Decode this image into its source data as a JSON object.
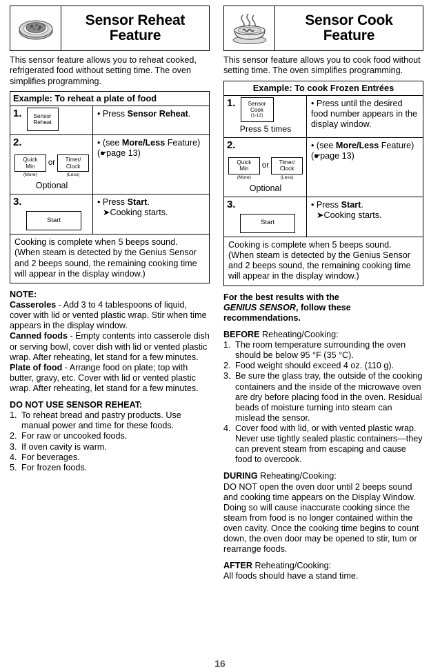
{
  "page": {
    "number": "16"
  },
  "left": {
    "header": {
      "icon": "plate-of-food-icon",
      "title_line1": "Sensor Reheat",
      "title_line2": "Feature"
    },
    "intro": "This sensor feature allows you to reheat cooked, refrigerated food without setting time. The oven simplifies programming.",
    "example": {
      "title": "Example: To reheat a plate of food",
      "steps": [
        {
          "num": "1.",
          "button": {
            "line1": "Sensor",
            "line2": "Reheat"
          },
          "instruction_pre": "• Press ",
          "instruction_bold": "Sensor Reheat",
          "instruction_post": "."
        },
        {
          "num": "2.",
          "btn_more": {
            "line1": "Quick",
            "line2": "Min"
          },
          "more_sub": "(More)",
          "or": "or",
          "btn_less": {
            "line1": "Timer/",
            "line2": "Clock"
          },
          "less_sub": "(Less)",
          "optional": "Optional",
          "instruction_pre": "• (see ",
          "instruction_bold": "More/Less",
          "instruction_post": " Feature)",
          "instruction_page": "page 13"
        },
        {
          "num": "3.",
          "button": {
            "line1": "Start"
          },
          "instruction_pre": "• Press ",
          "instruction_bold": "Start",
          "instruction_post": ".",
          "instruction_arrow": "➤Cooking starts."
        }
      ],
      "footer": "Cooking is complete when 5 beeps sound. (When steam is detected by the Genius Sensor and 2 beeps sound, the remaining cooking time will appear in the display window.)"
    },
    "note": {
      "heading": "NOTE:",
      "items": [
        {
          "bold": "Casseroles",
          "text": " - Add 3 to 4 tablespoons of liquid, cover with lid or vented plastic wrap. Stir when time appears in the display window."
        },
        {
          "bold": "Canned foods",
          "text": " - Empty contents into casserole dish or serving bowl, cover dish with lid or vented plastic wrap. After reheating, let stand for a few minutes."
        },
        {
          "bold": "Plate of food",
          "text": " - Arrange food on plate; top with butter, gravy, etc. Cover with lid or vented plastic wrap. After reheating, let stand for a few minutes."
        }
      ]
    },
    "donot": {
      "heading": "DO NOT USE SENSOR REHEAT:",
      "items": [
        {
          "n": "1.",
          "t": "To reheat bread and pastry products. Use manual power and time for these foods."
        },
        {
          "n": "2.",
          "t": "For raw or uncooked foods."
        },
        {
          "n": "3.",
          "t": "If oven cavity is warm."
        },
        {
          "n": "4.",
          "t": "For beverages."
        },
        {
          "n": "5.",
          "t": "For frozen foods."
        }
      ]
    }
  },
  "right": {
    "header": {
      "icon": "bowl-of-soup-icon",
      "title_line1": "Sensor Cook",
      "title_line2": "Feature"
    },
    "intro": "This sensor feature allows you to cook food without setting time. The oven simplifies programming.",
    "example": {
      "title": "Example: To cook Frozen Entrées",
      "steps": [
        {
          "num": "1.",
          "button": {
            "line1": "Sensor",
            "line2": "Cook",
            "line3": "(1-12)"
          },
          "press_times": "Press 5 times",
          "instruction": "• Press until the desired food number appears in the display window."
        },
        {
          "num": "2.",
          "btn_more": {
            "line1": "Quick",
            "line2": "Min"
          },
          "more_sub": "(More)",
          "or": "or",
          "btn_less": {
            "line1": "Timer/",
            "line2": "Clock"
          },
          "less_sub": "(Less)",
          "optional": "Optional",
          "instruction_pre": "• (see ",
          "instruction_bold": "More/Less",
          "instruction_post": " Feature)",
          "instruction_page": "page 13"
        },
        {
          "num": "3.",
          "button": {
            "line1": "Start"
          },
          "instruction_pre": "• Press ",
          "instruction_bold": "Start",
          "instruction_post": ".",
          "instruction_arrow": "➤Cooking starts."
        }
      ],
      "footer": "Cooking is complete when 5 beeps sound. (When steam is detected by the Genius Sensor and 2 beeps sound, the remaining cooking time will appear in the display window.)"
    },
    "best_results": {
      "line1": "For the best results with the",
      "emphasis": "GENIUS SENSOR",
      "line2_rest": ", follow these",
      "line3": "recommendations."
    },
    "before": {
      "label": "BEFORE",
      "label_rest": " Reheating/Cooking:",
      "items": [
        {
          "n": "1.",
          "t": "The room temperature surrounding the oven should be below 95 °F (35 °C)."
        },
        {
          "n": "2.",
          "t": "Food weight should exceed 4 oz. (110 g)."
        },
        {
          "n": "3.",
          "t": "Be sure the glass tray, the outside of the cooking containers and the inside of the microwave oven are dry before placing food in the oven. Residual beads of moisture turning into steam can mislead the sensor."
        },
        {
          "n": "4.",
          "t": "Cover food with lid, or with vented plastic wrap. Never use tightly sealed plastic containers—they can prevent steam from escaping and cause food to overcook."
        }
      ]
    },
    "during": {
      "label": "DURING",
      "label_rest": " Reheating/Cooking:",
      "text": "DO NOT open the oven door until 2 beeps sound and cooking time appears on the Display Window.  Doing so will cause inaccurate cooking since the steam from food is no longer contained within the oven cavity. Once the cooking time begins to count down, the oven door may be opened to stir, tum or rearrange foods."
    },
    "after": {
      "label": "AFTER",
      "label_rest": " Reheating/Cooking:",
      "text": "All foods should have a stand time."
    }
  }
}
